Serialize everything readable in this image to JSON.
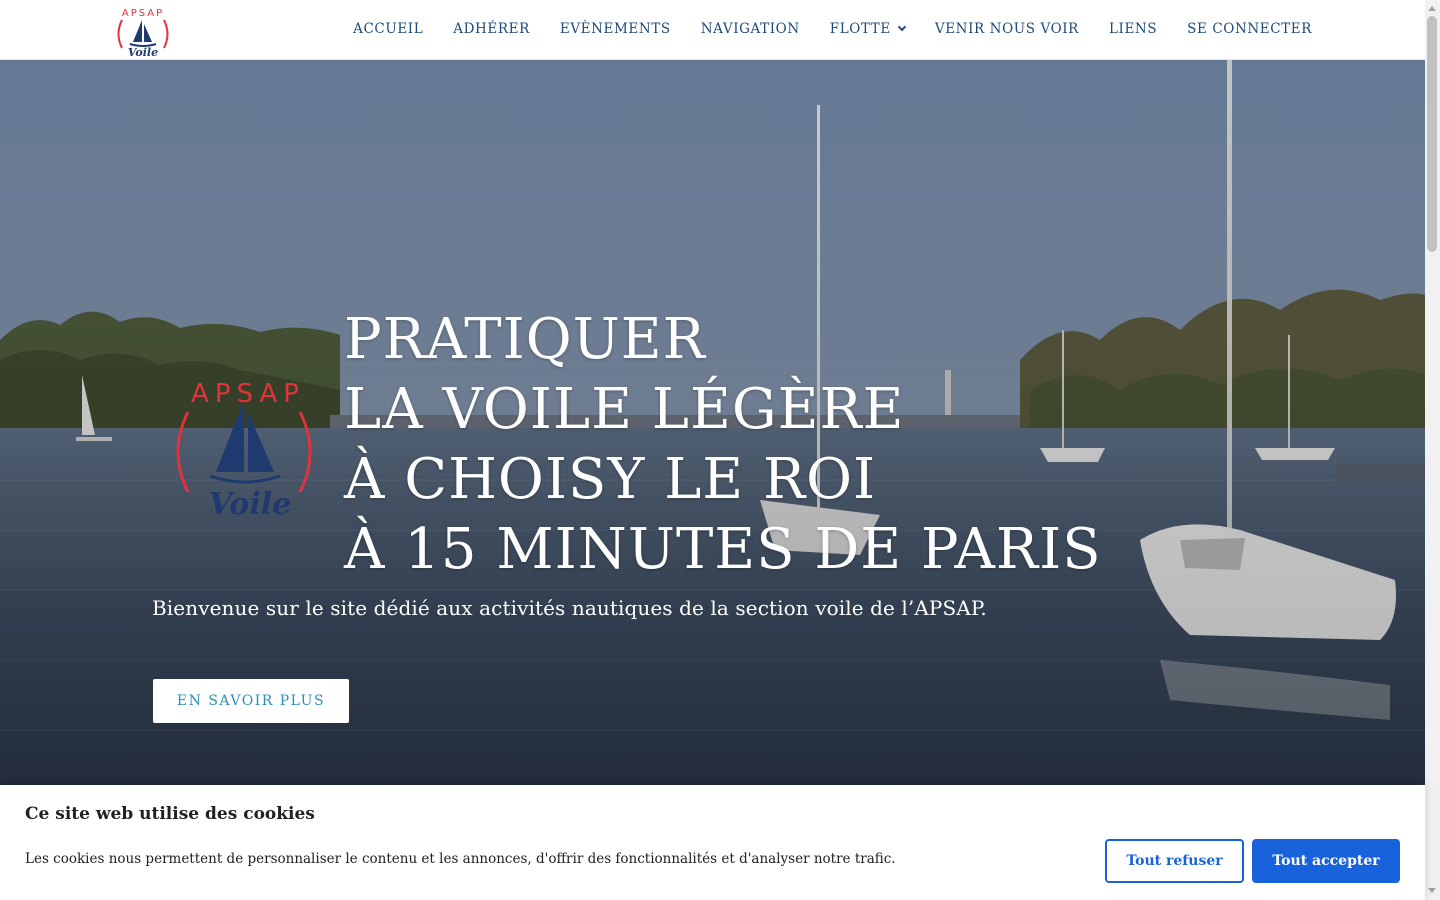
{
  "site": {
    "logo_text_top": "APSAP",
    "logo_text_bottom": "Voile",
    "brand_red": "#e0333c",
    "brand_navy": "#1e3a6e"
  },
  "nav": {
    "items": [
      {
        "label": "ACCUEIL"
      },
      {
        "label": "ADHÉRER"
      },
      {
        "label": "EVÈNEMENTS"
      },
      {
        "label": "NAVIGATION"
      },
      {
        "label": "FLOTTE",
        "has_dropdown": true
      },
      {
        "label": "VENIR NOUS VOIR"
      },
      {
        "label": "LIENS"
      },
      {
        "label": "SE CONNECTER"
      }
    ],
    "color": "#1e4a7a"
  },
  "hero": {
    "headline": [
      "PRATIQUER",
      "LA VOILE LÉGÈRE",
      "À CHOISY LE ROI",
      "À 15 MINUTES DE PARIS"
    ],
    "subtitle": "Bienvenue sur le site dédié aux activités nautiques de la section voile de l’APSAP.",
    "cta_label": "EN SAVOIR PLUS",
    "cta_color": "#2a8fb8"
  },
  "cookie_banner": {
    "title": "Ce site web utilise des cookies",
    "text": "Les cookies nous permettent de personnaliser le contenu et les annonces, d'offrir des fonctionnalités et d'analyser notre trafic.",
    "refuse_label": "Tout refuser",
    "accept_label": "Tout accepter",
    "accent": "#1863dc"
  }
}
